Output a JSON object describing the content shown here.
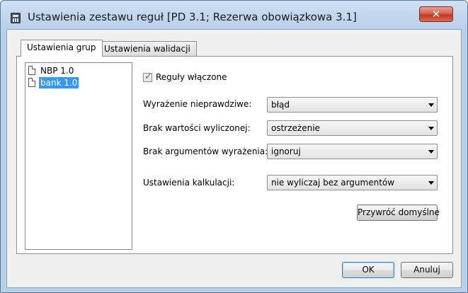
{
  "window": {
    "title": "Ustawienia zestawu reguł [PD 3.1; Rezerwa obowiązkowa 3.1]",
    "close_label": "✕",
    "icon": "calculator-icon"
  },
  "tabs": [
    {
      "label": "Ustawienia grup",
      "active": true
    },
    {
      "label": "Ustawienia walidacji",
      "active": false
    }
  ],
  "tree": {
    "items": [
      {
        "label": "NBP 1.0",
        "icon": "file-icon",
        "selected": false
      },
      {
        "label": "bank 1.0",
        "icon": "file-icon",
        "selected": true
      }
    ]
  },
  "rules_enabled": {
    "label": "Reguły włączone",
    "checked": true
  },
  "fields": {
    "false_expression": {
      "label": "Wyrażenie nieprawdziwe:",
      "value": "błąd"
    },
    "missing_value": {
      "label": "Brak wartości wyliczonej:",
      "value": "ostrzeżenie"
    },
    "missing_args": {
      "label": "Brak argumentów wyrażenia:",
      "value": "ignoruj"
    },
    "calc_settings": {
      "label": "Ustawienia kalkulacji:",
      "value": "nie wyliczaj bez argumentów"
    }
  },
  "buttons": {
    "restore_defaults": "Przywróć domyślne",
    "ok": "OK",
    "cancel": "Anuluj"
  }
}
